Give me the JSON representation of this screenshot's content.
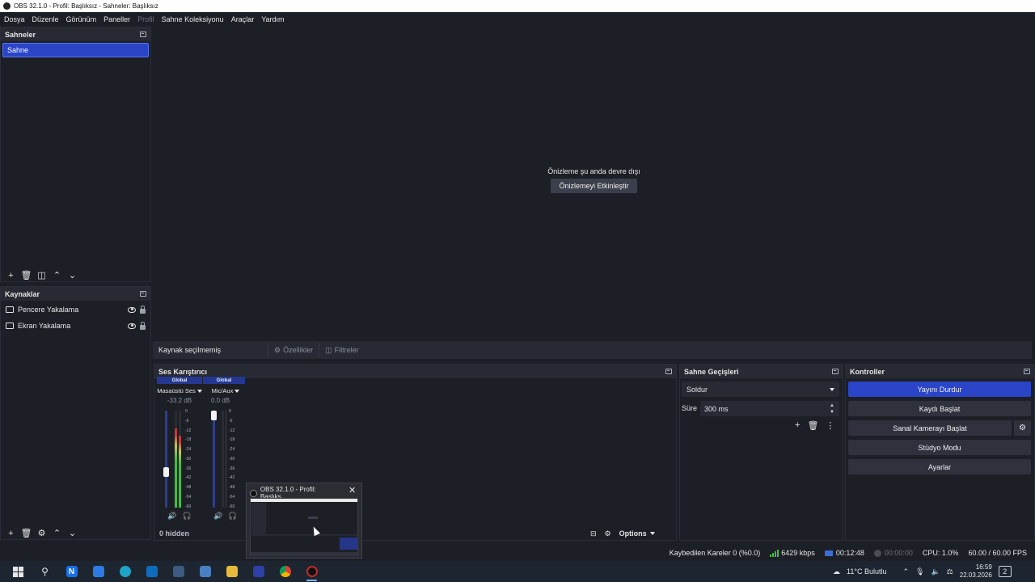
{
  "window": {
    "title": "OBS 32.1.0 - Profil: Başlıksız - Sahneler: Başlıksız"
  },
  "menu": {
    "items": [
      {
        "label": "Dosya"
      },
      {
        "label": "Düzenle"
      },
      {
        "label": "Görünüm"
      },
      {
        "label": "Paneller"
      },
      {
        "label": "Profil"
      },
      {
        "label": "Sahne Koleksiyonu"
      },
      {
        "label": "Araçlar"
      },
      {
        "label": "Yardım"
      }
    ]
  },
  "scenes": {
    "title": "Sahneler",
    "items": [
      {
        "label": "Sahne",
        "selected": true
      }
    ]
  },
  "sources": {
    "title": "Kaynaklar",
    "items": [
      {
        "label": "Pencere Yakalama",
        "visible": true,
        "locked": false
      },
      {
        "label": "Ekran Yakalama",
        "visible": true,
        "locked": false
      }
    ]
  },
  "preview": {
    "message": "Önizleme şu anda devre dışı",
    "enable_button": "Önizlemeyi Etkinleştir"
  },
  "context": {
    "no_source": "Kaynak seçilmemiş",
    "properties": "Özellikler",
    "filters": "Filtreler"
  },
  "mixer": {
    "title": "Ses Karıştırıcı",
    "channels": [
      {
        "tag": "Global",
        "name": "Masaüstü Ses",
        "db": "-33.2 dB",
        "fader_level": 0.35,
        "meter_level": 0.82,
        "accent": "#3fbf3f"
      },
      {
        "tag": "Global",
        "name": "Mic/Aux",
        "db": "0.0 dB",
        "fader_level": 1.0,
        "meter_level": 0.0,
        "accent": "#3fbf3f"
      }
    ],
    "scale": [
      "0",
      "-6",
      "-12",
      "-18",
      "-24",
      "-30",
      "-36",
      "-42",
      "-48",
      "-54",
      "-60"
    ],
    "hidden": "0 hidden",
    "options": "Options"
  },
  "transitions": {
    "title": "Sahne Geçişleri",
    "selected": "Soldur",
    "duration_label": "Süre",
    "duration_value": "300 ms"
  },
  "controls": {
    "title": "Kontroller",
    "stop_stream": "Yayını Durdur",
    "start_recording": "Kaydı Başlat",
    "start_virtualcam": "Sanal Kamerayı Başlat",
    "studio_mode": "Stüdyo Modu",
    "settings": "Ayarlar",
    "accent": "#2b45c9"
  },
  "status": {
    "dropped_frames": "Kaybedilen Kareler 0 (%0.0)",
    "bitrate": "6429 kbps",
    "stream_time": "00:12:48",
    "record_time": "00:00:00",
    "cpu": "CPU: 1.0%",
    "fps": "60.00 / 60.00 FPS"
  },
  "thumbnail": {
    "title": "OBS 32.1.0 - Profil: Başlıks..."
  },
  "taskbar": {
    "weather": "11°C  Bulutlu",
    "time": "16:59",
    "date": "22.03.2026",
    "notifications": "2"
  }
}
